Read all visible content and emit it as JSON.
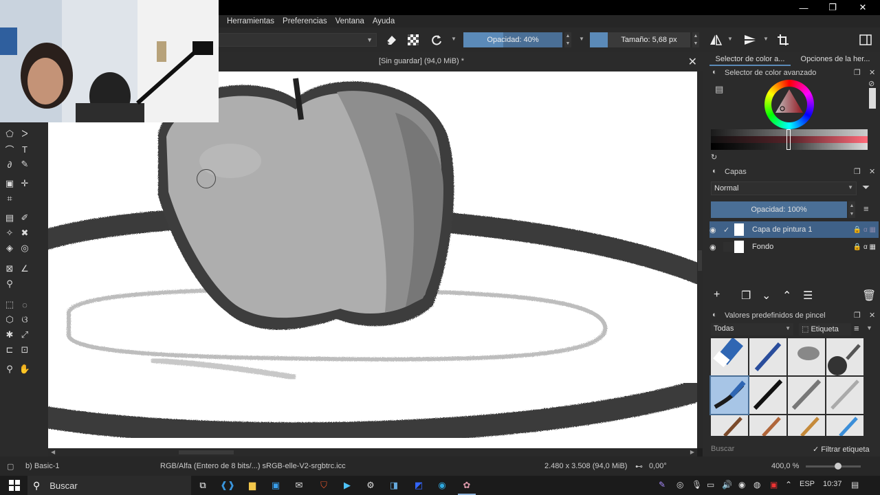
{
  "window": {
    "minimize": "—",
    "restore": "❐",
    "close": "✕"
  },
  "menu": [
    "Herramientas",
    "Preferencias",
    "Ventana",
    "Ayuda"
  ],
  "toolbar": {
    "opacity_label": "Opacidad: 40%",
    "opacity_value": 40,
    "size_label": "Tamaño: 5,68 px"
  },
  "document": {
    "title": "[Sin guardar]  (94,0 MiB) *",
    "close": "✕"
  },
  "docker": {
    "tabs": [
      "Selector de color a...",
      "Opciones de la her..."
    ],
    "color_selector_title": "Selector de color avanzado",
    "layers_title": "Capas",
    "blend_mode": "Normal",
    "layer_opacity": "Opacidad:  100%",
    "layers": [
      {
        "name": "Capa de pintura 1",
        "selected": true
      },
      {
        "name": "Fondo",
        "selected": false
      }
    ],
    "brush_presets_title": "Valores predefinidos de pincel",
    "brush_filter": "Todas",
    "tag_label": "Etiqueta",
    "search_placeholder": "Buscar",
    "filter_tag_label": "Filtrar etiqueta"
  },
  "status": {
    "brush": "b) Basic-1",
    "color_space": "RGB/Alfa (Entero de 8 bits/...)  sRGB-elle-V2-srgbtrc.icc",
    "dimensions": "2.480 x 3.508 (94,0 MiB)",
    "rotation": "0,00°",
    "zoom": "400,0 %"
  },
  "taskbar": {
    "search_label": "Buscar",
    "language": "ESP",
    "time": "10:37"
  },
  "colors": {
    "accent": "#4a6f96",
    "layer_selected": "#3f6188",
    "canvas": "#ffffff"
  }
}
